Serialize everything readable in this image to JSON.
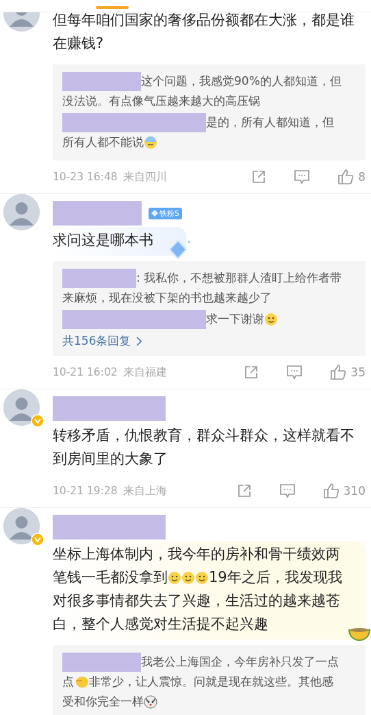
{
  "comments": [
    {
      "kind": "plain",
      "cut_off_top": true,
      "verified": false,
      "lines": [
        [
          {
            "kind": "text",
            "text": "但每年咱们国家的奢侈品份额都在大涨，都是谁"
          }
        ],
        [
          {
            "kind": "text",
            "text": "在赚钱?"
          }
        ]
      ],
      "replies": [
        {
          "lines": [
            [
              {
                "kind": "redaction-s"
              },
              {
                "kind": "text",
                "text": "这个问题，我感觉90%的人都知道，但"
              }
            ],
            [
              {
                "kind": "text",
                "text": "没法说。有点像气压越来越大的高压锅"
              }
            ]
          ]
        },
        {
          "lines": [
            [
              {
                "kind": "redaction-l"
              },
              {
                "kind": "text",
                "text": "是的，所有人都知道，但"
              }
            ],
            [
              {
                "kind": "text",
                "text": "所有人都不能说"
              },
              {
                "kind": "cold"
              }
            ]
          ]
        }
      ],
      "time": "10-23 16:48",
      "location": "来自四川",
      "likes": "8"
    },
    {
      "kind": "diamond-bubble",
      "cut_off_top": false,
      "verified": false,
      "badge": "铁粉5",
      "lines": [
        [
          {
            "kind": "text",
            "text": "求问这是哪本书"
          }
        ]
      ],
      "replies": [
        {
          "lines": [
            [
              {
                "kind": "redaction-m"
              },
              {
                "kind": "text",
                "text": ": 我私你，不想被那群人渣盯上给作者带"
              }
            ],
            [
              {
                "kind": "text",
                "text": "来麻烦，现在没被下架的书也越来越少了"
              }
            ]
          ]
        },
        {
          "lines": [
            [
              {
                "kind": "redaction-l"
              },
              {
                "kind": "text",
                "text": "求一下谢谢"
              },
              {
                "kind": "smile"
              }
            ]
          ]
        }
      ],
      "more_replies": "共156条回复",
      "time": "10-21 16:02",
      "location": "来自福建",
      "likes": "35"
    },
    {
      "kind": "plain",
      "cut_off_top": false,
      "verified": true,
      "lines": [
        [
          {
            "kind": "text",
            "text": "转移矛盾，仇恨教育，群众斗群众，这样就看不"
          }
        ],
        [
          {
            "kind": "text",
            "text": "到房间里的大象了"
          }
        ]
      ],
      "time": "10-21 19:28",
      "location": "来自上海",
      "likes": "310"
    },
    {
      "kind": "melon-bubble",
      "cut_off_top": false,
      "verified": true,
      "lines": [
        [
          {
            "kind": "text",
            "text": "坐标上海体制内，我今年的房补和骨干绩效两"
          }
        ],
        [
          {
            "kind": "text",
            "text": "笔钱一毛都没拿到"
          },
          {
            "kind": "smile"
          },
          {
            "kind": "smile"
          },
          {
            "kind": "smile"
          },
          {
            "kind": "text",
            "text": "19年之后，我发现我"
          }
        ],
        [
          {
            "kind": "text",
            "text": "对很多事情都失去了兴趣，生活过的越来越苍"
          }
        ],
        [
          {
            "kind": "text",
            "text": "白，整个人感觉对生活提不起兴趣"
          }
        ]
      ],
      "replies": [
        {
          "lines": [
            [
              {
                "kind": "redaction-s"
              },
              {
                "kind": "text",
                "text": "我老公上海国企，今年房补只发了一点"
              }
            ],
            [
              {
                "kind": "text",
                "text": "点"
              },
              {
                "kind": "smirk"
              },
              {
                "kind": "text",
                "text": "非常少，让人震惊。问就是现在就这些。其他感"
              }
            ],
            [
              {
                "kind": "text",
                "text": "受和你完全一样"
              },
              {
                "kind": "dog"
              }
            ]
          ]
        }
      ]
    }
  ]
}
